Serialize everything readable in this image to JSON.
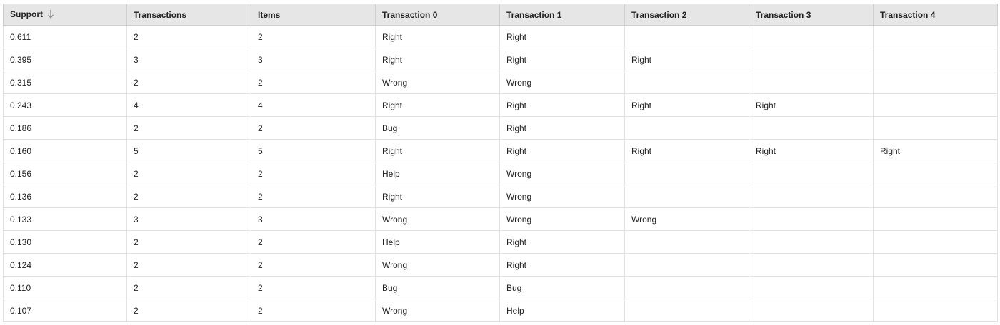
{
  "table": {
    "columns": [
      {
        "label": "Support",
        "sorted": "descending",
        "sort_icon": "arrow-down-icon"
      },
      {
        "label": "Transactions"
      },
      {
        "label": "Items"
      },
      {
        "label": "Transaction 0"
      },
      {
        "label": "Transaction 1"
      },
      {
        "label": "Transaction 2"
      },
      {
        "label": "Transaction 3"
      },
      {
        "label": "Transaction 4"
      }
    ],
    "rows": [
      [
        "0.611",
        "2",
        "2",
        "Right",
        "Right",
        "",
        "",
        ""
      ],
      [
        "0.395",
        "3",
        "3",
        "Right",
        "Right",
        "Right",
        "",
        ""
      ],
      [
        "0.315",
        "2",
        "2",
        "Wrong",
        "Wrong",
        "",
        "",
        ""
      ],
      [
        "0.243",
        "4",
        "4",
        "Right",
        "Right",
        "Right",
        "Right",
        ""
      ],
      [
        "0.186",
        "2",
        "2",
        "Bug",
        "Right",
        "",
        "",
        ""
      ],
      [
        "0.160",
        "5",
        "5",
        "Right",
        "Right",
        "Right",
        "Right",
        "Right"
      ],
      [
        "0.156",
        "2",
        "2",
        "Help",
        "Wrong",
        "",
        "",
        ""
      ],
      [
        "0.136",
        "2",
        "2",
        "Right",
        "Wrong",
        "",
        "",
        ""
      ],
      [
        "0.133",
        "3",
        "3",
        "Wrong",
        "Wrong",
        "Wrong",
        "",
        ""
      ],
      [
        "0.130",
        "2",
        "2",
        "Help",
        "Right",
        "",
        "",
        ""
      ],
      [
        "0.124",
        "2",
        "2",
        "Wrong",
        "Right",
        "",
        "",
        ""
      ],
      [
        "0.110",
        "2",
        "2",
        "Bug",
        "Bug",
        "",
        "",
        ""
      ],
      [
        "0.107",
        "2",
        "2",
        "Wrong",
        "Help",
        "",
        "",
        ""
      ]
    ]
  },
  "colors": {
    "header_bg": "#e6e6e6",
    "border": "#e3e3e3",
    "text": "#222222",
    "sort_icon": "#8a8a8a"
  }
}
